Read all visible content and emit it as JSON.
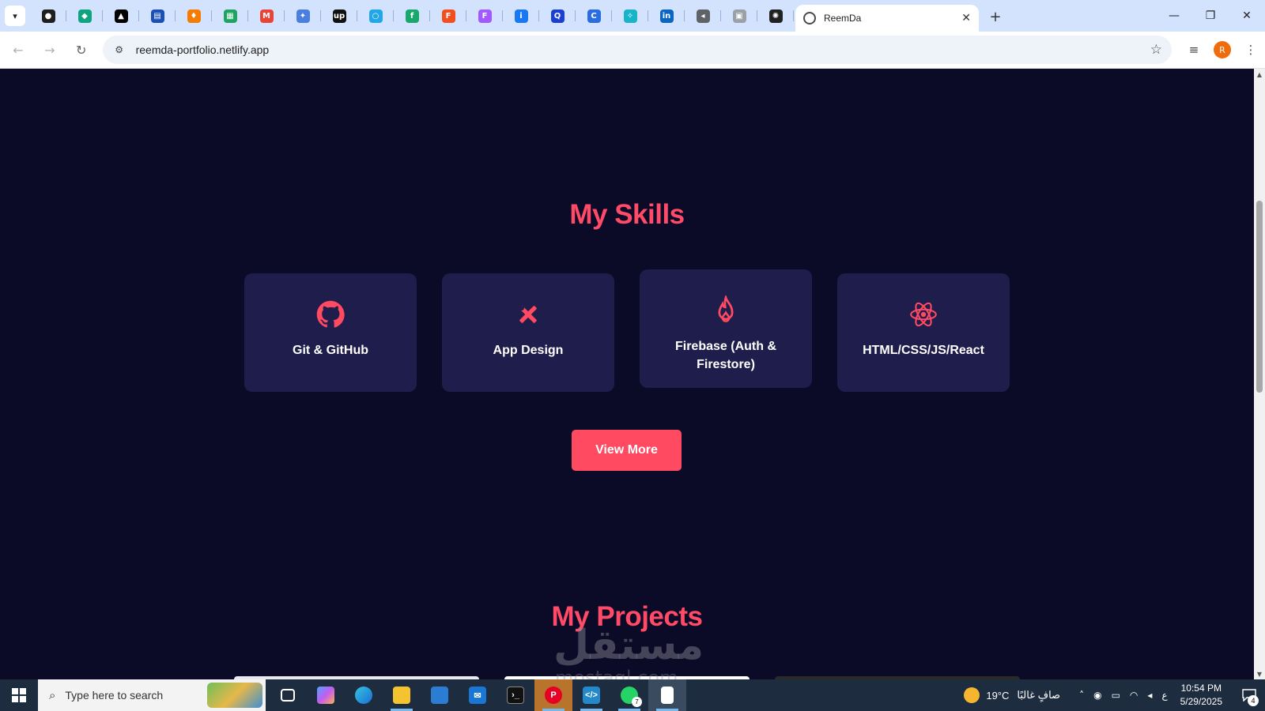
{
  "browser": {
    "tab_title": "ReemDa",
    "url": "reemda-portfolio.netlify.app",
    "profile_initial": "R",
    "pinned_tabs": [
      {
        "icon": "github-icon",
        "color": "#1f1f1f",
        "glyph": "●"
      },
      {
        "icon": "diamond-app-icon",
        "color": "#10a37f",
        "glyph": "◆"
      },
      {
        "icon": "triangle-app-icon",
        "color": "#000000",
        "glyph": "▲"
      },
      {
        "icon": "dashboard-app-icon",
        "color": "#1a4fb5",
        "glyph": "▤"
      },
      {
        "icon": "fire-app-icon",
        "color": "#f57c00",
        "glyph": "♦"
      },
      {
        "icon": "sheets-app-icon",
        "color": "#1ea362",
        "glyph": "▦"
      },
      {
        "icon": "gmail-icon",
        "color": "#ea4335",
        "glyph": "M"
      },
      {
        "icon": "gemini-icon",
        "color": "#4a7fe0",
        "glyph": "✦"
      },
      {
        "icon": "upwork-icon",
        "color": "#111111",
        "glyph": "up"
      },
      {
        "icon": "circle-app-icon",
        "color": "#21a6e8",
        "glyph": "○"
      },
      {
        "icon": "freelancer-app-icon",
        "color": "#19a86b",
        "glyph": "f"
      },
      {
        "icon": "figma-icon",
        "color": "#f24e1e",
        "glyph": "F"
      },
      {
        "icon": "figma-alt-icon",
        "color": "#a259ff",
        "glyph": "F"
      },
      {
        "icon": "info-app-icon",
        "color": "#1877f2",
        "glyph": "i"
      },
      {
        "icon": "q-app-icon",
        "color": "#1a3fd1",
        "glyph": "Q"
      },
      {
        "icon": "canva-icon",
        "color": "#2a6de0",
        "glyph": "C"
      },
      {
        "icon": "shapes-app-icon",
        "color": "#17b4c9",
        "glyph": "✧"
      },
      {
        "icon": "linkedin-icon",
        "color": "#0a66c2",
        "glyph": "in"
      },
      {
        "icon": "speaker-icon",
        "color": "#5f6368",
        "glyph": "◂"
      },
      {
        "icon": "image-app-icon",
        "color": "#9aa0a6",
        "glyph": "▣"
      },
      {
        "icon": "openai-icon",
        "color": "#202123",
        "glyph": "✺"
      }
    ]
  },
  "page": {
    "skills_title": "My Skills",
    "projects_title": "My Projects",
    "view_more": "View More",
    "accent": "#ff4a68",
    "skills": [
      {
        "label": "Git & GitHub",
        "icon": "github-icon"
      },
      {
        "label": "App Design",
        "icon": "design-tools-icon"
      },
      {
        "label": "Firebase (Auth & Firestore)",
        "icon": "firebase-flame-icon"
      },
      {
        "label": "HTML/CSS/JS/React",
        "icon": "react-icon"
      }
    ],
    "watermark": "مستقل",
    "watermark_sub": "mostaql.com"
  },
  "taskbar": {
    "search_placeholder": "Type here to search",
    "whatsapp_badge": "7",
    "weather_temp": "19°C",
    "weather_text": "صافٍ غالبًا",
    "lang": "ع",
    "time": "10:54 PM",
    "date": "5/29/2025",
    "notifications": "4"
  }
}
